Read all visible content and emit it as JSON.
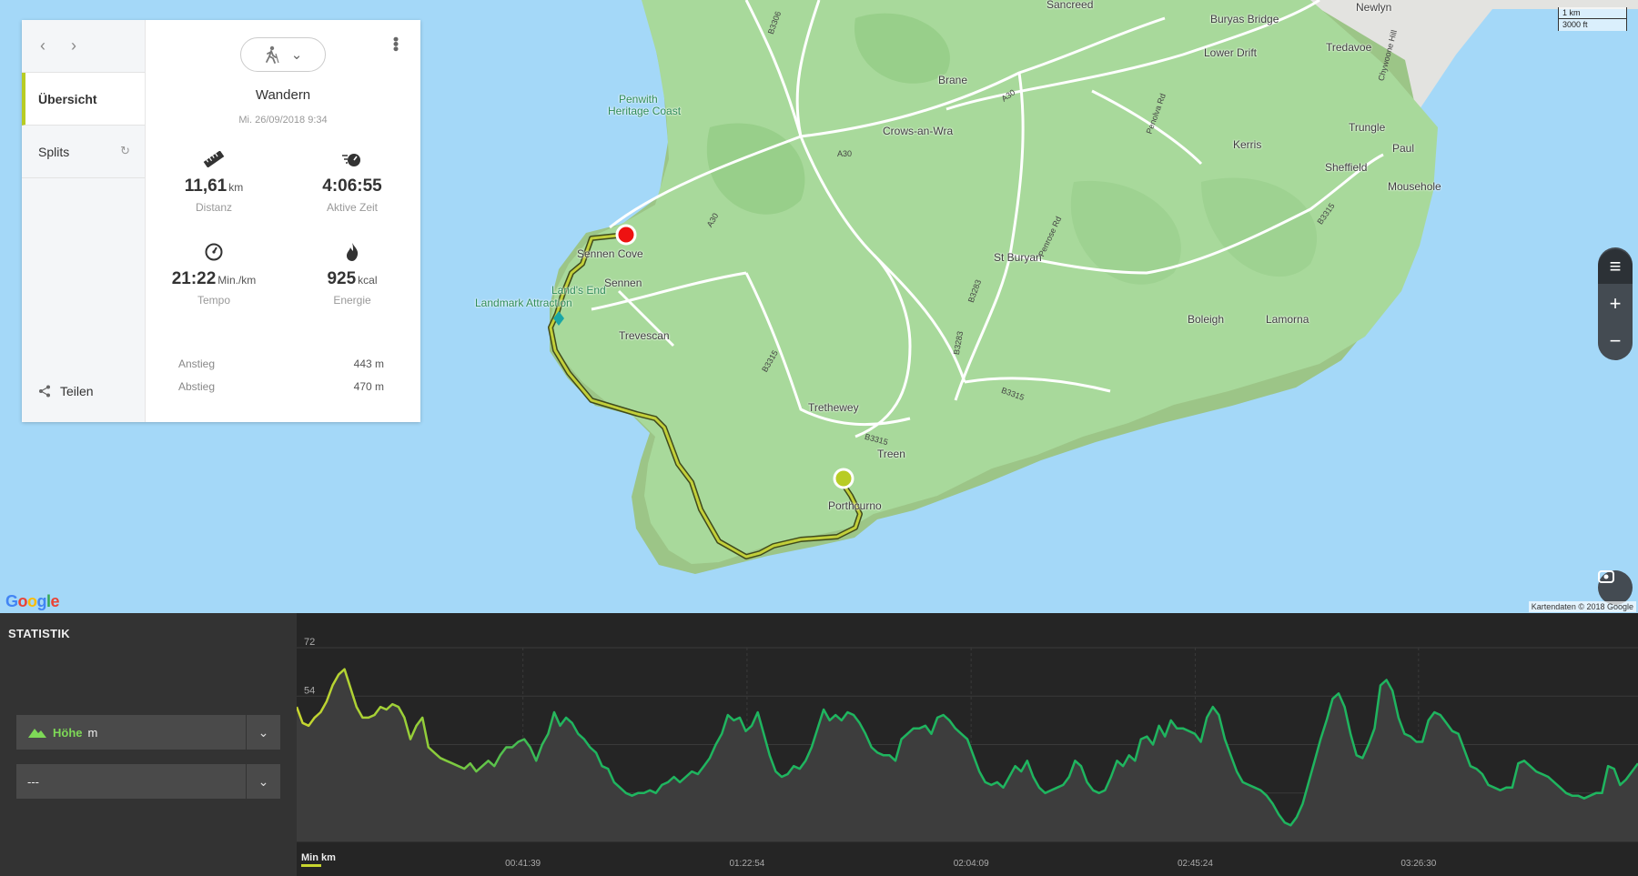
{
  "map": {
    "places": [
      {
        "name": "Sancreed",
        "cls": "place"
      },
      {
        "name": "Buryas Bridge",
        "cls": "place"
      },
      {
        "name": "Newlyn",
        "cls": "place"
      },
      {
        "name": "Lower Drift",
        "cls": "place"
      },
      {
        "name": "Tredavoe",
        "cls": "place"
      },
      {
        "name": "Brane",
        "cls": "place"
      },
      {
        "name": "Penwith",
        "cls": "place poi"
      },
      {
        "name": "Heritage Coast",
        "cls": "place poi"
      },
      {
        "name": "Crows-an-Wra",
        "cls": "place"
      },
      {
        "name": "Trungle",
        "cls": "place"
      },
      {
        "name": "Kerris",
        "cls": "place"
      },
      {
        "name": "Paul",
        "cls": "place"
      },
      {
        "name": "Sheffield",
        "cls": "place"
      },
      {
        "name": "Mousehole",
        "cls": "place"
      },
      {
        "name": "Sennen Cove",
        "cls": "place"
      },
      {
        "name": "St Buryan",
        "cls": "place"
      },
      {
        "name": "Sennen",
        "cls": "place"
      },
      {
        "name": "Land's End",
        "cls": "place poi"
      },
      {
        "name": "Landmark Attraction",
        "cls": "place poi"
      },
      {
        "name": "Boleigh",
        "cls": "place"
      },
      {
        "name": "Lamorna",
        "cls": "place"
      },
      {
        "name": "Trevescan",
        "cls": "place"
      },
      {
        "name": "Trethewey",
        "cls": "place"
      },
      {
        "name": "Treen",
        "cls": "place"
      },
      {
        "name": "Porthcurno",
        "cls": "place"
      }
    ],
    "roads": [
      "B3306",
      "A30",
      "A30",
      "A30",
      "Penolva Rd",
      "Chywoone Hill",
      "B3315",
      "Penrose Rd",
      "B3283",
      "B3283",
      "B3315",
      "B3315",
      "B3315"
    ],
    "scale": {
      "km": "1 km",
      "ft": "3000 ft"
    },
    "credit": "Kartendaten © 2018 Google",
    "google_letters": [
      "G",
      "o",
      "o",
      "g",
      "l",
      "e"
    ]
  },
  "card": {
    "nav": {
      "overview": "Übersicht",
      "splits": "Splits",
      "share": "Teilen"
    },
    "activity": "Wandern",
    "date": "Mi. 26/09/2018 9:34",
    "stats": [
      {
        "value": "11,61",
        "unit": "km",
        "label": "Distanz",
        "icon": "ruler-icon"
      },
      {
        "value": "4:06:55",
        "unit": "",
        "label": "Aktive Zeit",
        "icon": "stopwatch-icon"
      },
      {
        "value": "21:22",
        "unit": "Min./km",
        "label": "Tempo",
        "icon": "speedometer-icon"
      },
      {
        "value": "925",
        "unit": "kcal",
        "label": "Energie",
        "icon": "flame-icon"
      }
    ],
    "ascent": {
      "label": "Anstieg",
      "value": "443 m"
    },
    "descent": {
      "label": "Abstieg",
      "value": "470 m"
    }
  },
  "stats_panel": {
    "title": "STATISTIK",
    "metric1": {
      "name": "Höhe",
      "unit": "m"
    },
    "metric2": {
      "name": "---"
    },
    "x_unit": "Min km"
  },
  "chart_data": {
    "type": "area",
    "title": "",
    "xlabel": "",
    "ylabel": "",
    "ylim": [
      0,
      72
    ],
    "yticks": [
      0,
      18,
      36,
      54,
      72
    ],
    "xlim_minutes": [
      0,
      246.9
    ],
    "xtick_labels": [
      "00:41:39",
      "01:22:54",
      "02:04:09",
      "02:45:24",
      "03:26:30"
    ],
    "xtick_minutes": [
      41.65,
      82.9,
      124.15,
      165.4,
      206.5
    ],
    "series": [
      {
        "values_m": [
          50,
          44,
          43,
          46,
          48,
          52,
          58,
          62,
          64,
          57,
          50,
          46,
          46,
          47,
          50,
          49,
          51,
          50,
          46,
          38,
          43,
          46,
          35,
          33,
          31,
          30,
          29,
          28,
          27,
          29,
          26,
          28,
          30,
          28,
          32,
          35,
          35,
          37,
          38,
          35,
          30,
          36,
          40,
          48,
          43,
          46,
          44,
          40,
          38,
          35,
          33,
          28,
          27,
          22,
          20,
          18,
          17,
          18,
          18,
          19,
          18,
          21,
          22,
          24,
          22,
          24,
          26,
          25,
          28,
          31,
          36,
          40,
          47,
          45,
          46,
          41,
          43,
          48,
          40,
          32,
          26,
          24,
          25,
          28,
          27,
          30,
          35,
          42,
          49,
          45,
          47,
          45,
          48,
          47,
          44,
          40,
          35,
          33,
          32,
          32,
          30,
          38,
          40,
          42,
          42,
          43,
          40,
          46,
          47,
          45,
          42,
          40,
          38,
          32,
          26,
          22,
          21,
          22,
          20,
          24,
          28,
          26,
          30,
          24,
          20,
          18,
          19,
          20,
          21,
          24,
          30,
          28,
          22,
          19,
          18,
          19,
          24,
          30,
          28,
          32,
          30,
          38,
          39,
          36,
          43,
          39,
          45,
          42,
          42,
          41,
          40,
          37,
          46,
          50,
          47,
          38,
          32,
          26,
          22,
          21,
          20,
          19,
          17,
          14,
          10,
          7,
          6,
          9,
          14,
          22,
          30,
          38,
          45,
          53,
          55,
          50,
          40,
          32,
          31,
          36,
          42,
          58,
          60,
          56,
          46,
          40,
          39,
          37,
          37,
          45,
          48,
          47,
          44,
          41,
          40,
          34,
          28,
          27,
          25,
          21,
          20,
          19,
          20,
          20,
          29,
          30,
          28,
          26,
          25,
          24,
          22,
          20,
          18,
          17,
          17,
          16,
          17,
          18,
          18,
          28,
          27,
          21,
          23,
          26,
          29
        ]
      }
    ]
  }
}
